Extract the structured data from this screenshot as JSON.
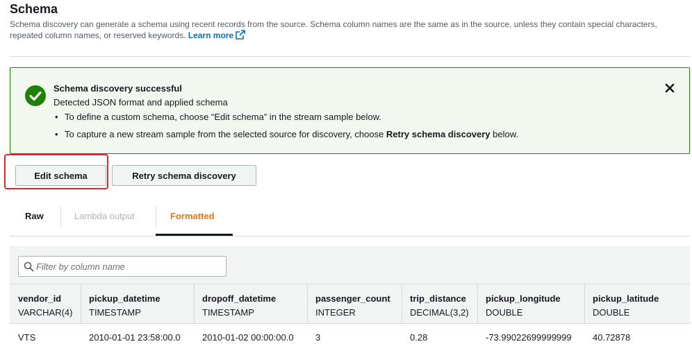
{
  "header": {
    "title": "Schema",
    "description": "Schema discovery can generate a schema using recent records from the source. Schema column names are the same as in the source, unless they contain special characters, repeated column names, or reserved keywords.",
    "learn_more": "Learn more"
  },
  "alert": {
    "title": "Schema discovery successful",
    "body": "Detected JSON format and applied schema",
    "bullet1": "To define a custom schema, choose “Edit schema” in the stream sample below.",
    "bullet2_pre": "To capture a new stream sample from the selected source for discovery, choose ",
    "bullet2_bold": "Retry schema discovery",
    "bullet2_post": " below.",
    "status_color": "#1d8102"
  },
  "actions": {
    "edit_schema": "Edit schema",
    "retry_discovery": "Retry schema discovery"
  },
  "tabs": [
    {
      "label": "Raw",
      "state": "normal"
    },
    {
      "label": "Lambda output",
      "state": "disabled"
    },
    {
      "label": "Formatted",
      "state": "selected"
    }
  ],
  "filter": {
    "placeholder": "Filter by column name"
  },
  "table": {
    "columns": [
      {
        "name": "vendor_id",
        "type": "VARCHAR(4)"
      },
      {
        "name": "pickup_datetime",
        "type": "TIMESTAMP"
      },
      {
        "name": "dropoff_datetime",
        "type": "TIMESTAMP"
      },
      {
        "name": "passenger_count",
        "type": "INTEGER"
      },
      {
        "name": "trip_distance",
        "type": "DECIMAL(3,2)"
      },
      {
        "name": "pickup_longitude",
        "type": "DOUBLE"
      },
      {
        "name": "pickup_latitude",
        "type": "DOUBLE"
      }
    ],
    "rows": [
      [
        "VTS",
        "2010-01-01 23:58:00.0",
        "2010-01-02 00:00:00.0",
        "3",
        "0.28",
        "-73.99022699999999",
        "40.72878"
      ]
    ]
  },
  "colors": {
    "accent_orange": "#ec7211",
    "link_blue": "#0073bb",
    "highlight_red": "#e5242b"
  }
}
